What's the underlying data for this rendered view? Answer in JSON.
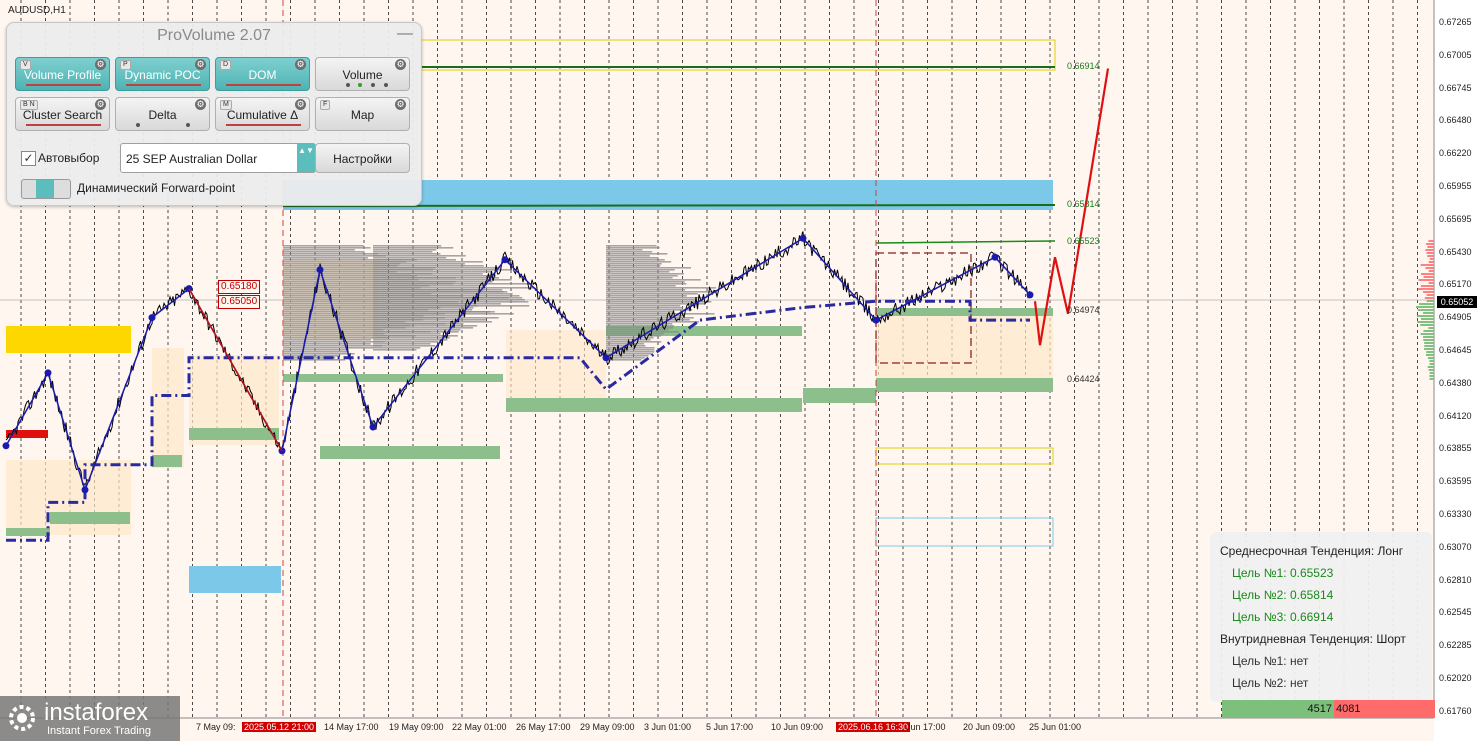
{
  "symbol": "AUDUSD,H1",
  "panel": {
    "title": "ProVolume 2.07",
    "minimize": "—",
    "buttons": [
      {
        "label": "Volume Profile",
        "hotkey": "V",
        "active": true
      },
      {
        "label": "Dynamic POC",
        "hotkey": "P",
        "active": true
      },
      {
        "label": "DOM",
        "hotkey": "D",
        "active": true
      },
      {
        "label": "Volume",
        "hotkey": "",
        "active": false
      },
      {
        "label": "Cluster Search",
        "hotkey": "B  N",
        "active": false
      },
      {
        "label": "Delta",
        "hotkey": "",
        "active": false
      },
      {
        "label": "Cumulative Δ",
        "hotkey": "M",
        "active": false
      },
      {
        "label": "Map",
        "hotkey": "F",
        "active": false
      }
    ],
    "autoselect_checked": "✓",
    "autoselect_label": "Автовыбор",
    "instrument": "25 SEP Australian Dollar",
    "spin": "▲▼",
    "settings_label": "Настройки",
    "forward_point_label": "Динамический Forward-point"
  },
  "price_axis": [
    "0.67265",
    "0.67005",
    "0.66745",
    "0.66480",
    "0.66220",
    "0.65955",
    "0.65695",
    "0.65430",
    "0.65170",
    "0.64905",
    "0.64645",
    "0.64380",
    "0.64120",
    "0.63855",
    "0.63595",
    "0.63330",
    "0.63070",
    "0.62810",
    "0.62545",
    "0.62285",
    "0.62020",
    "0.61760"
  ],
  "current_price": "0.65052",
  "level_labels": [
    {
      "text": "0.66914",
      "color": "#1a7a1a"
    },
    {
      "text": "0.65814",
      "color": "#1a7a1a"
    },
    {
      "text": "0.65523",
      "color": "#1a7a1a"
    },
    {
      "text": "0.64974",
      "color": "#333333"
    },
    {
      "text": "0.64424",
      "color": "#333333"
    }
  ],
  "red_labels": [
    "0.65180",
    "0.65050"
  ],
  "date_labels": [
    {
      "text": "7 May 09:",
      "highlight": false
    },
    {
      "text": "2025.05.12 21:00",
      "highlight": true
    },
    {
      "text": "14 May 17:00",
      "highlight": false
    },
    {
      "text": "19 May 09:00",
      "highlight": false
    },
    {
      "text": "22 May 01:00",
      "highlight": false
    },
    {
      "text": "26 May 17:00",
      "highlight": false
    },
    {
      "text": "29 May 09:00",
      "highlight": false
    },
    {
      "text": "3 Jun 01:00",
      "highlight": false
    },
    {
      "text": "5 Jun 17:00",
      "highlight": false
    },
    {
      "text": "10 Jun 09:00",
      "highlight": false
    },
    {
      "text": "2025.06.16 16:30",
      "highlight": true
    },
    {
      "text": "Jun 17:00",
      "highlight": false
    },
    {
      "text": "20 Jun 09:00",
      "highlight": false
    },
    {
      "text": "25 Jun 01:00",
      "highlight": false
    }
  ],
  "info": {
    "mid_trend": "Среднесрочная Тенденция: Лонг",
    "mid_targets": [
      "Цель №1: 0.65523",
      "Цель №2: 0.65814",
      "Цель №3: 0.66914"
    ],
    "intra_trend": "Внутридневная Тенденция: Шорт",
    "intra_targets": [
      "Цель №1: нет",
      "Цель №2: нет"
    ],
    "target_color": "#1a8a1a"
  },
  "volume_bar": {
    "buy": "4517",
    "sell": "4081"
  },
  "logo": {
    "name": "instaforex",
    "tagline": "Instant Forex Trading"
  },
  "chart_data": {
    "type": "line",
    "series": [
      {
        "values": [
          0.639,
          0.6448,
          0.6355,
          0.6492,
          0.6515,
          0.6386,
          0.653,
          0.6405,
          0.6538,
          0.646,
          0.6555,
          0.649,
          0.654,
          0.651
        ]
      }
    ],
    "forecast": [
      0.6505,
      0.647,
      0.654,
      0.6495,
      0.669
    ],
    "ylim": [
      0.6176,
      0.6727
    ],
    "levels": [
      0.66914,
      0.65814,
      0.65523,
      0.64974,
      0.64424
    ]
  }
}
